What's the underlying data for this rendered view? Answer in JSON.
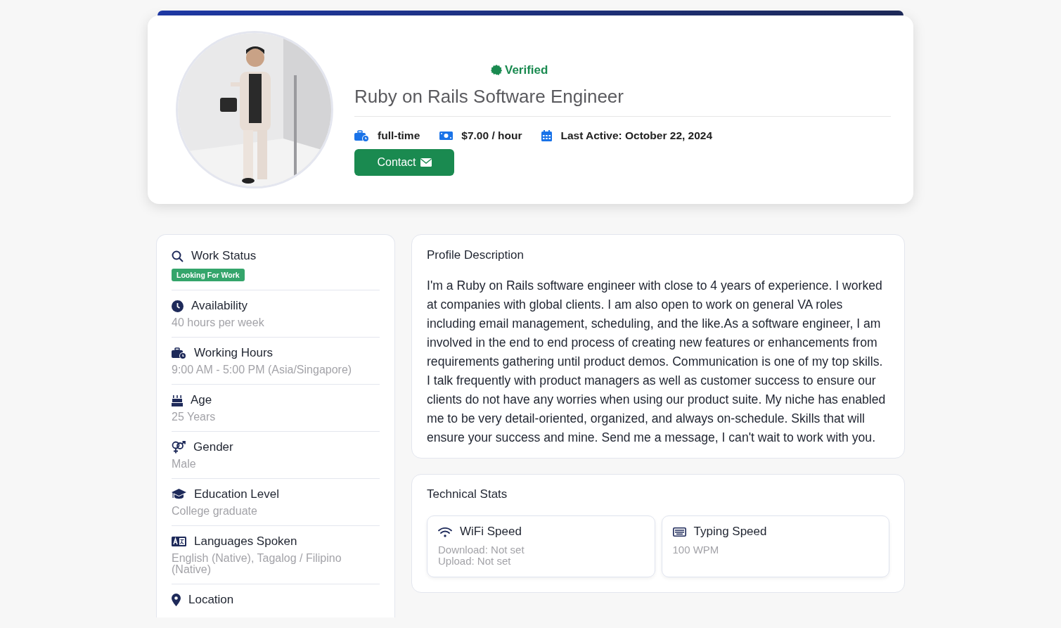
{
  "header": {
    "verified": "Verified",
    "title": "Ruby on Rails Software Engineer",
    "meta": [
      {
        "kind": "employment",
        "text": "full-time"
      },
      {
        "kind": "rate",
        "text": "$7.00 / hour"
      },
      {
        "kind": "date",
        "text": "Last Active: October 22, 2024"
      }
    ],
    "contact_button": "Contact"
  },
  "sidebar": {
    "items": [
      {
        "kind": "status",
        "label": "Work Status",
        "badge": "Looking For Work"
      },
      {
        "kind": "availability",
        "label": "Availability",
        "value": "40 hours per week"
      },
      {
        "kind": "hours",
        "label": "Working Hours",
        "value": "9:00 AM - 5:00 PM (Asia/Singapore)"
      },
      {
        "kind": "age",
        "label": "Age",
        "value": "25 Years"
      },
      {
        "kind": "gender",
        "label": "Gender",
        "value": "Male"
      },
      {
        "kind": "education",
        "label": "Education Level",
        "value": "College graduate"
      },
      {
        "kind": "languages",
        "label": "Languages Spoken",
        "value": "English (Native), Tagalog / Filipino (Native)"
      },
      {
        "kind": "location",
        "label": "Location"
      }
    ]
  },
  "profile_description": {
    "title": "Profile Description",
    "text": "I'm a Ruby on Rails software engineer with close to 4 years of experience. I worked at companies with global clients. I am also open to work on general VA roles including email management, scheduling, and the like.As a software engineer, I am involved in the end to end process of creating new features or enhancements from requirements gathering until product demos. Communication is one of my top skills. I talk frequently with product managers as well as customer success to ensure our clients do not have any worries when using our product suite. My niche has enabled me to be very detail-oriented, organized, and always on-schedule. Skills that will ensure your success and mine. Send me a message, I can't wait to work with you."
  },
  "technical_stats": {
    "title": "Technical Stats",
    "items": [
      {
        "kind": "wifi",
        "label": "WiFi Speed",
        "lines": [
          "Download: Not set",
          "Upload: Not set"
        ]
      },
      {
        "kind": "typing",
        "label": "Typing Speed",
        "lines": [
          "100 WPM"
        ]
      }
    ]
  }
}
